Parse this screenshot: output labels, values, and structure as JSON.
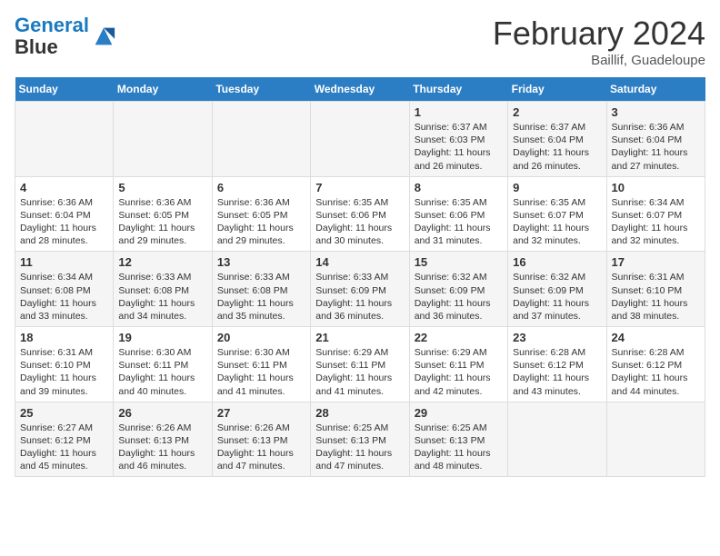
{
  "header": {
    "logo_line1": "General",
    "logo_line2": "Blue",
    "main_title": "February 2024",
    "subtitle": "Baillif, Guadeloupe"
  },
  "weekdays": [
    "Sunday",
    "Monday",
    "Tuesday",
    "Wednesday",
    "Thursday",
    "Friday",
    "Saturday"
  ],
  "weeks": [
    [
      {
        "day": "",
        "info": ""
      },
      {
        "day": "",
        "info": ""
      },
      {
        "day": "",
        "info": ""
      },
      {
        "day": "",
        "info": ""
      },
      {
        "day": "1",
        "info": "Sunrise: 6:37 AM\nSunset: 6:03 PM\nDaylight: 11 hours\nand 26 minutes."
      },
      {
        "day": "2",
        "info": "Sunrise: 6:37 AM\nSunset: 6:04 PM\nDaylight: 11 hours\nand 26 minutes."
      },
      {
        "day": "3",
        "info": "Sunrise: 6:36 AM\nSunset: 6:04 PM\nDaylight: 11 hours\nand 27 minutes."
      }
    ],
    [
      {
        "day": "4",
        "info": "Sunrise: 6:36 AM\nSunset: 6:04 PM\nDaylight: 11 hours\nand 28 minutes."
      },
      {
        "day": "5",
        "info": "Sunrise: 6:36 AM\nSunset: 6:05 PM\nDaylight: 11 hours\nand 29 minutes."
      },
      {
        "day": "6",
        "info": "Sunrise: 6:36 AM\nSunset: 6:05 PM\nDaylight: 11 hours\nand 29 minutes."
      },
      {
        "day": "7",
        "info": "Sunrise: 6:35 AM\nSunset: 6:06 PM\nDaylight: 11 hours\nand 30 minutes."
      },
      {
        "day": "8",
        "info": "Sunrise: 6:35 AM\nSunset: 6:06 PM\nDaylight: 11 hours\nand 31 minutes."
      },
      {
        "day": "9",
        "info": "Sunrise: 6:35 AM\nSunset: 6:07 PM\nDaylight: 11 hours\nand 32 minutes."
      },
      {
        "day": "10",
        "info": "Sunrise: 6:34 AM\nSunset: 6:07 PM\nDaylight: 11 hours\nand 32 minutes."
      }
    ],
    [
      {
        "day": "11",
        "info": "Sunrise: 6:34 AM\nSunset: 6:08 PM\nDaylight: 11 hours\nand 33 minutes."
      },
      {
        "day": "12",
        "info": "Sunrise: 6:33 AM\nSunset: 6:08 PM\nDaylight: 11 hours\nand 34 minutes."
      },
      {
        "day": "13",
        "info": "Sunrise: 6:33 AM\nSunset: 6:08 PM\nDaylight: 11 hours\nand 35 minutes."
      },
      {
        "day": "14",
        "info": "Sunrise: 6:33 AM\nSunset: 6:09 PM\nDaylight: 11 hours\nand 36 minutes."
      },
      {
        "day": "15",
        "info": "Sunrise: 6:32 AM\nSunset: 6:09 PM\nDaylight: 11 hours\nand 36 minutes."
      },
      {
        "day": "16",
        "info": "Sunrise: 6:32 AM\nSunset: 6:09 PM\nDaylight: 11 hours\nand 37 minutes."
      },
      {
        "day": "17",
        "info": "Sunrise: 6:31 AM\nSunset: 6:10 PM\nDaylight: 11 hours\nand 38 minutes."
      }
    ],
    [
      {
        "day": "18",
        "info": "Sunrise: 6:31 AM\nSunset: 6:10 PM\nDaylight: 11 hours\nand 39 minutes."
      },
      {
        "day": "19",
        "info": "Sunrise: 6:30 AM\nSunset: 6:11 PM\nDaylight: 11 hours\nand 40 minutes."
      },
      {
        "day": "20",
        "info": "Sunrise: 6:30 AM\nSunset: 6:11 PM\nDaylight: 11 hours\nand 41 minutes."
      },
      {
        "day": "21",
        "info": "Sunrise: 6:29 AM\nSunset: 6:11 PM\nDaylight: 11 hours\nand 41 minutes."
      },
      {
        "day": "22",
        "info": "Sunrise: 6:29 AM\nSunset: 6:11 PM\nDaylight: 11 hours\nand 42 minutes."
      },
      {
        "day": "23",
        "info": "Sunrise: 6:28 AM\nSunset: 6:12 PM\nDaylight: 11 hours\nand 43 minutes."
      },
      {
        "day": "24",
        "info": "Sunrise: 6:28 AM\nSunset: 6:12 PM\nDaylight: 11 hours\nand 44 minutes."
      }
    ],
    [
      {
        "day": "25",
        "info": "Sunrise: 6:27 AM\nSunset: 6:12 PM\nDaylight: 11 hours\nand 45 minutes."
      },
      {
        "day": "26",
        "info": "Sunrise: 6:26 AM\nSunset: 6:13 PM\nDaylight: 11 hours\nand 46 minutes."
      },
      {
        "day": "27",
        "info": "Sunrise: 6:26 AM\nSunset: 6:13 PM\nDaylight: 11 hours\nand 47 minutes."
      },
      {
        "day": "28",
        "info": "Sunrise: 6:25 AM\nSunset: 6:13 PM\nDaylight: 11 hours\nand 47 minutes."
      },
      {
        "day": "29",
        "info": "Sunrise: 6:25 AM\nSunset: 6:13 PM\nDaylight: 11 hours\nand 48 minutes."
      },
      {
        "day": "",
        "info": ""
      },
      {
        "day": "",
        "info": ""
      }
    ]
  ]
}
